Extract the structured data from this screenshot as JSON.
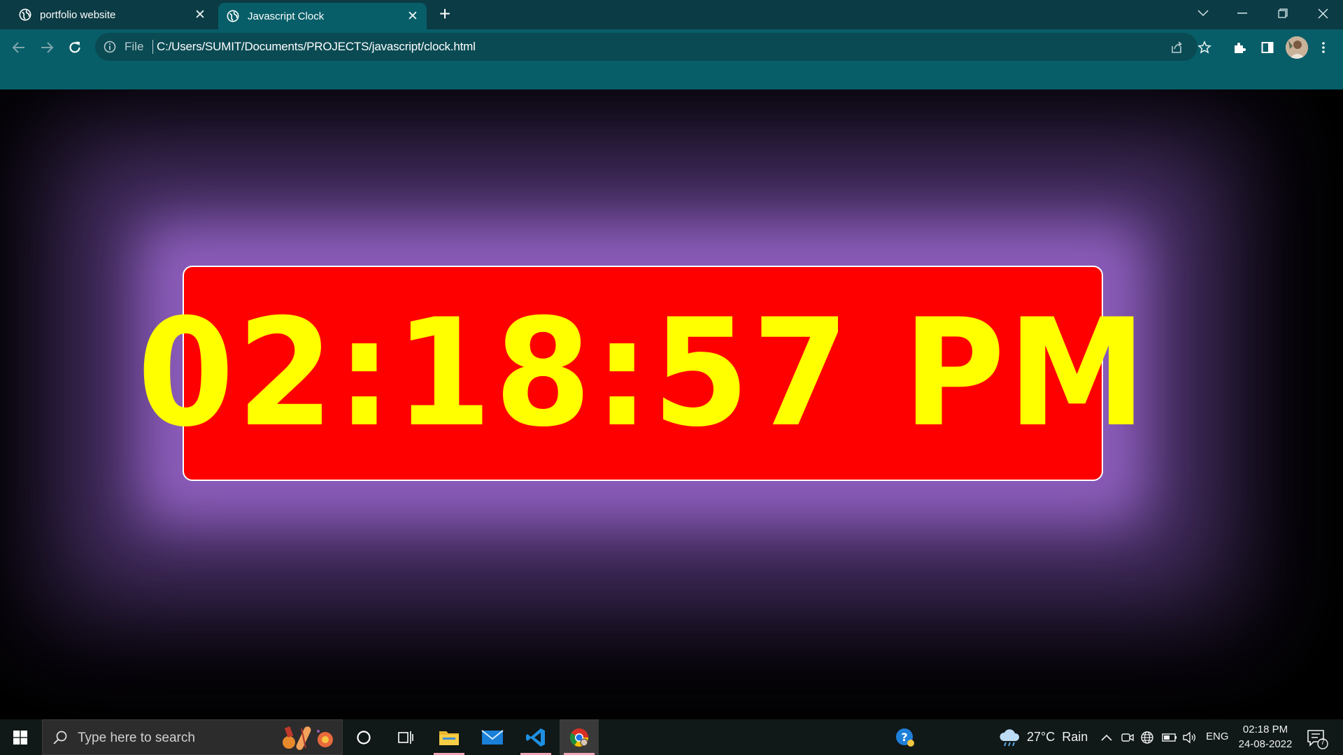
{
  "tabs": [
    {
      "title": "portfolio website",
      "active": false,
      "icon": "globe-icon"
    },
    {
      "title": "Javascript Clock",
      "active": true,
      "icon": "globe-icon"
    }
  ],
  "address_bar": {
    "scheme_label": "File",
    "url": "C:/Users/SUMIT/Documents/PROJECTS/javascript/clock.html"
  },
  "clock": {
    "time": "02:18:57 PM"
  },
  "taskbar": {
    "search_placeholder": "Type here to search",
    "weather": {
      "temperature": "27°C",
      "condition": "Rain"
    },
    "language": "ENG",
    "time": "02:18 PM",
    "date": "24-08-2022",
    "notification_count": "7"
  },
  "colors": {
    "chrome_frame": "#0b3b44",
    "chrome_toolbar": "#075e68",
    "clock_background": "#ff0000",
    "clock_text": "#ffff00",
    "glow": "#9a6cc8"
  }
}
